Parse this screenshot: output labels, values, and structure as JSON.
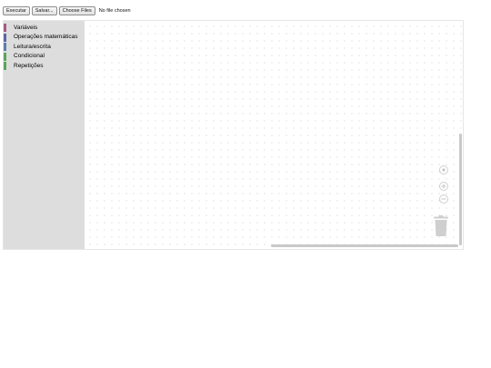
{
  "toolbar": {
    "run_label": "Executar",
    "save_label": "Salvar...",
    "choose_files_label": "Choose Files",
    "file_status": "No file chosen"
  },
  "toolbox": {
    "categories": [
      {
        "label": "Variáveis",
        "color": "#a55b80"
      },
      {
        "label": "Operações matemáticas",
        "color": "#5b67a5"
      },
      {
        "label": "Leitura/escrita",
        "color": "#5b80a5"
      },
      {
        "label": "Condicional",
        "color": "#5ba55b"
      },
      {
        "label": "Repetições",
        "color": "#5ba55b"
      }
    ]
  },
  "controls": {
    "zoom_reset_icon": "target-icon",
    "zoom_in_icon": "plus-icon",
    "zoom_out_icon": "minus-icon",
    "trash_icon": "trash-icon"
  }
}
